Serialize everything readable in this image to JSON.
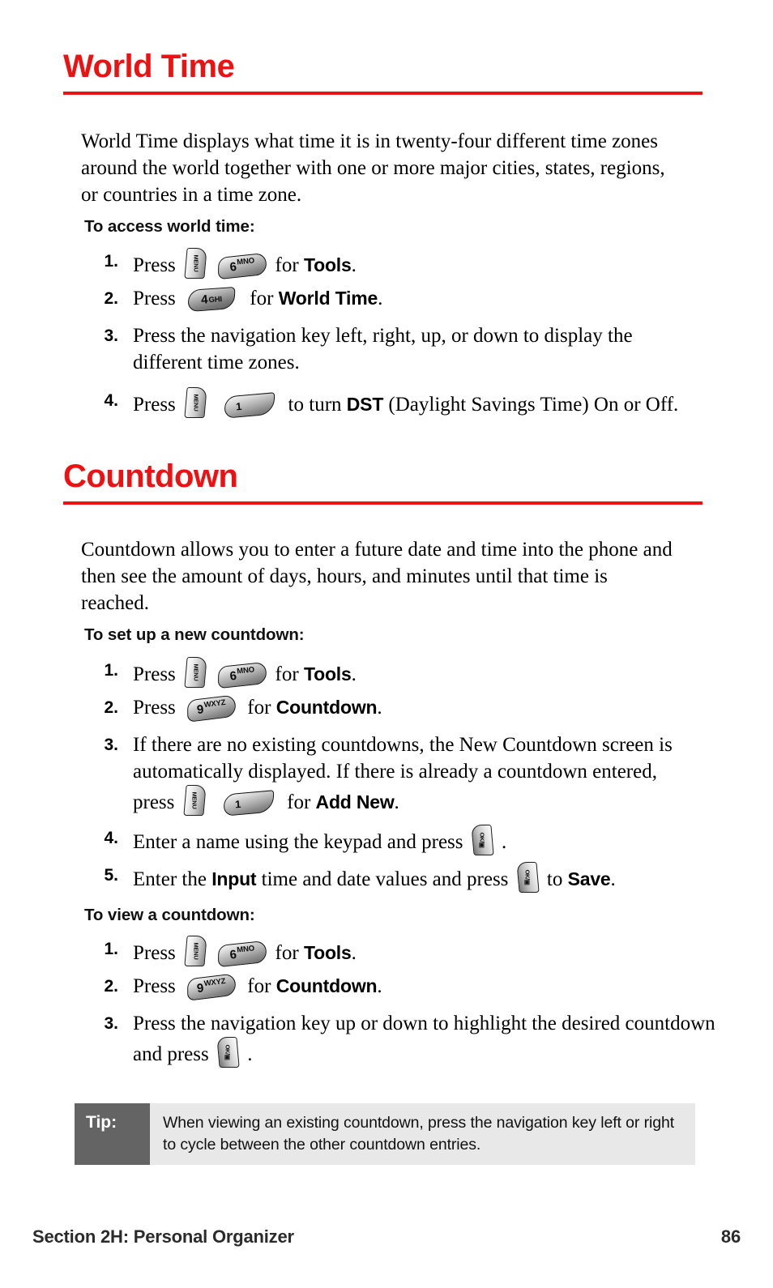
{
  "document": {
    "type": "phone-user-guide-page",
    "accent_color": "#ee1111",
    "tip_label_bg": "#646464",
    "tip_body_bg": "#e8e8e8"
  },
  "sections": [
    {
      "heading": "World Time",
      "intro": "World Time displays what time it is in twenty-four different time zones around the world together with one or more major cities, states, regions, or countries in a time zone.",
      "subhead": "To access world time:",
      "steps": [
        {
          "num": "1.",
          "pre": "Press",
          "post": "for",
          "bold": "Tools",
          "tail": "."
        },
        {
          "num": "2.",
          "pre": "Press",
          "post": "for",
          "bold": "World Time",
          "tail": "."
        },
        {
          "num": "3.",
          "text": "Press the navigation key left, right, up, or down to display the different time zones."
        },
        {
          "num": "4.",
          "pre": "Press",
          "post": "to turn",
          "bold": "DST",
          "tail": " (Daylight Savings Time) On or Off."
        }
      ]
    },
    {
      "heading": "Countdown",
      "intro": "Countdown allows you to enter a future date and time into the phone and then see the amount of days, hours, and minutes until that time is reached.",
      "subhead": "To set up a new countdown:",
      "steps": [
        {
          "num": "1.",
          "pre": "Press",
          "post": "for",
          "bold": "Tools",
          "tail": "."
        },
        {
          "num": "2.",
          "pre": "Press",
          "post": "for",
          "bold": "Countdown",
          "tail": "."
        },
        {
          "num": "3.",
          "pre": "If there are no existing countdowns, the New Countdown screen is automatically displayed. If there is already a countdown entered, press",
          "post": "for",
          "bold": "Add New",
          "tail": "."
        },
        {
          "num": "4.",
          "pre": "Enter a name using the keypad and press",
          "tail": "."
        },
        {
          "num": "5.",
          "pre": "Enter the",
          "bold": "Input",
          "mid": "time and date values and press",
          "post": "to",
          "bold2": "Save",
          "tail": "."
        }
      ],
      "subhead2": "To view a countdown:",
      "steps2": [
        {
          "num": "1.",
          "pre": "Press",
          "post": "for",
          "bold": "Tools",
          "tail": "."
        },
        {
          "num": "2.",
          "pre": "Press",
          "post": "for",
          "bold": "Countdown",
          "tail": "."
        },
        {
          "num": "3.",
          "pre": "Press the navigation key up or down to highlight the desired countdown and press",
          "tail": "."
        }
      ]
    }
  ],
  "keys": {
    "menu": {
      "label": "MENU",
      "name": "menu-key"
    },
    "ok": {
      "label": "OK/▣",
      "name": "ok-key"
    },
    "six": {
      "digit": "6",
      "letters": "MNO"
    },
    "nine": {
      "digit": "9",
      "letters": "WXYZ"
    },
    "four": {
      "digit": "4",
      "letters": "GHI"
    },
    "one": {
      "digit": "1",
      "letters": ""
    }
  },
  "tip": {
    "label": "Tip:",
    "text": "When viewing an existing countdown, press the navigation key left or right to cycle between the other countdown entries."
  },
  "footer": {
    "section": "Section 2H: Personal Organizer",
    "page_number": "86"
  }
}
